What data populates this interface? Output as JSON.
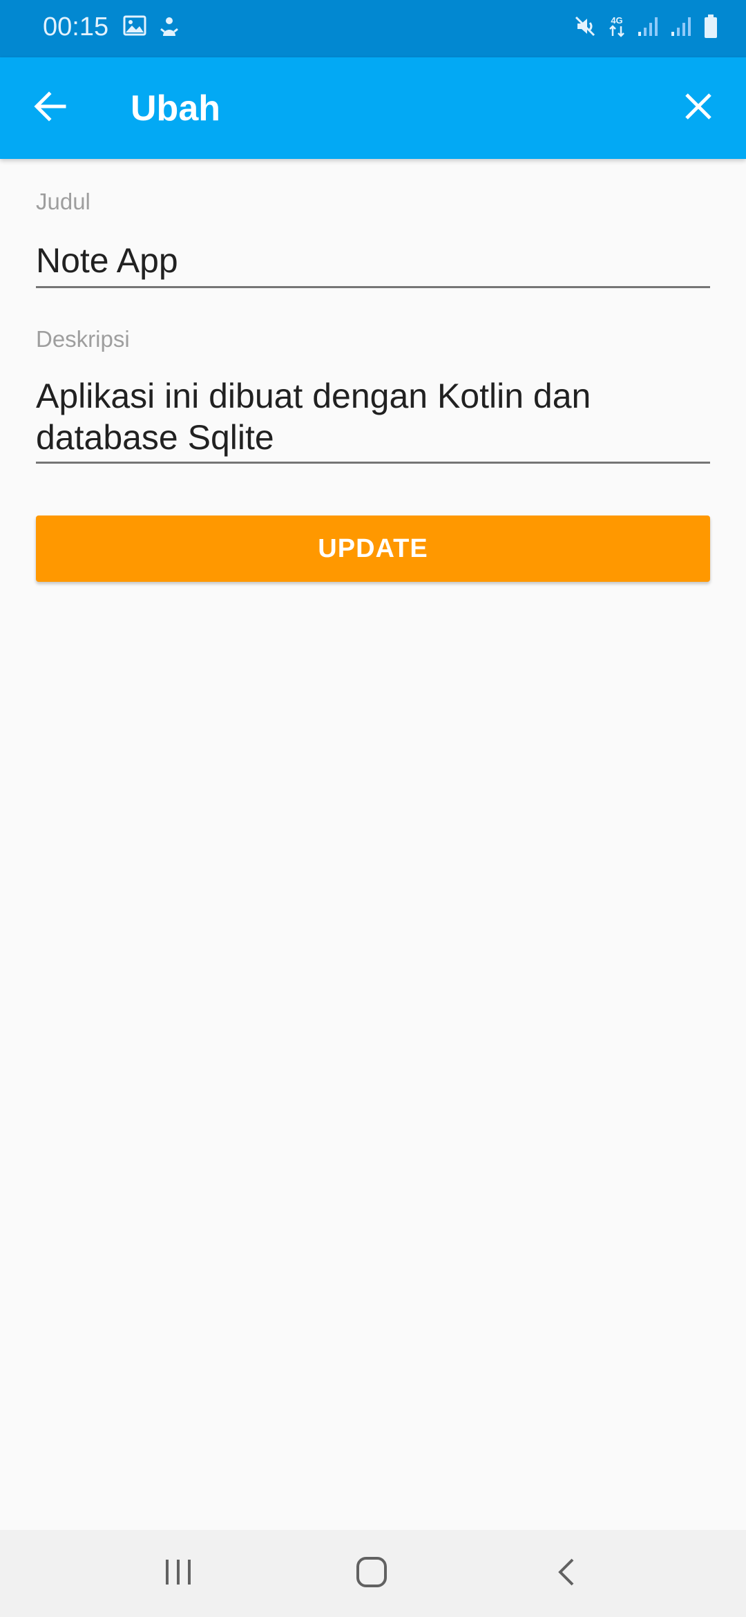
{
  "status_bar": {
    "time": "00:15",
    "left_icons": [
      "image-icon",
      "sailor-icon"
    ],
    "right_icons": [
      "mute-icon",
      "network-4g-icon",
      "signal-icon",
      "signal-icon",
      "battery-icon"
    ],
    "network_label": "4G"
  },
  "app_bar": {
    "title": "Ubah",
    "back_icon": "arrow-left-icon",
    "close_icon": "close-icon",
    "color": "#03a9f4"
  },
  "form": {
    "judul": {
      "label": "Judul",
      "value": "Note App"
    },
    "deskripsi": {
      "label": "Deskripsi",
      "value": "Aplikasi ini dibuat dengan Kotlin dan database Sqlite"
    },
    "update_button": {
      "label": "UPDATE",
      "color": "#ff9800"
    }
  },
  "nav_bar": {
    "buttons": [
      "recents-icon",
      "home-icon",
      "back-icon"
    ]
  }
}
